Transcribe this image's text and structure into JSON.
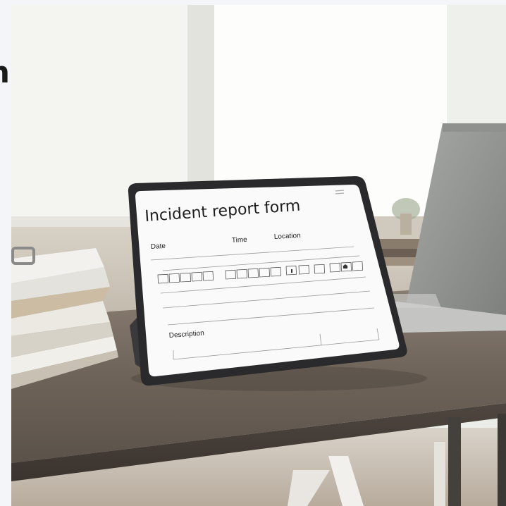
{
  "page_left_text": "n",
  "tablet": {
    "form_title": "Incident report form",
    "fields": {
      "date_label": "Date",
      "time_label": "Time",
      "location_label": "Location",
      "description_label": "Description"
    },
    "menu_icon": "menu-icon"
  },
  "colors": {
    "page_bg": "#f3f5f8",
    "desk": "#6f645a",
    "tablet_bezel": "#2a2a2c",
    "screen": "#fafafa"
  }
}
